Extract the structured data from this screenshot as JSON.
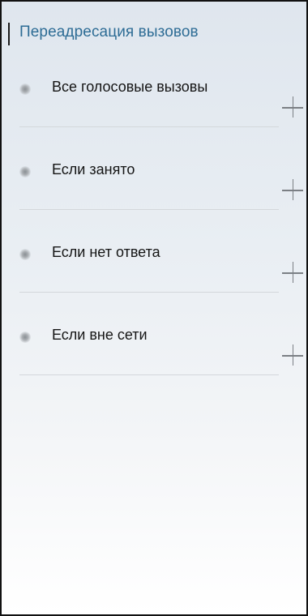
{
  "header": {
    "title": "Переадресация вызовов"
  },
  "items": [
    {
      "label": "Все голосовые вызовы",
      "icon": "status-dot-icon",
      "action_icon": "plus-icon"
    },
    {
      "label": "Если занято",
      "icon": "status-dot-icon",
      "action_icon": "plus-icon"
    },
    {
      "label": "Если нет ответа",
      "icon": "status-dot-icon",
      "action_icon": "plus-icon"
    },
    {
      "label": "Если вне сети",
      "icon": "status-dot-icon",
      "action_icon": "plus-icon"
    }
  ],
  "colors": {
    "title": "#2d6c95",
    "text": "#151515",
    "divider": "#d3d7db",
    "plus": "#7b7f84"
  }
}
